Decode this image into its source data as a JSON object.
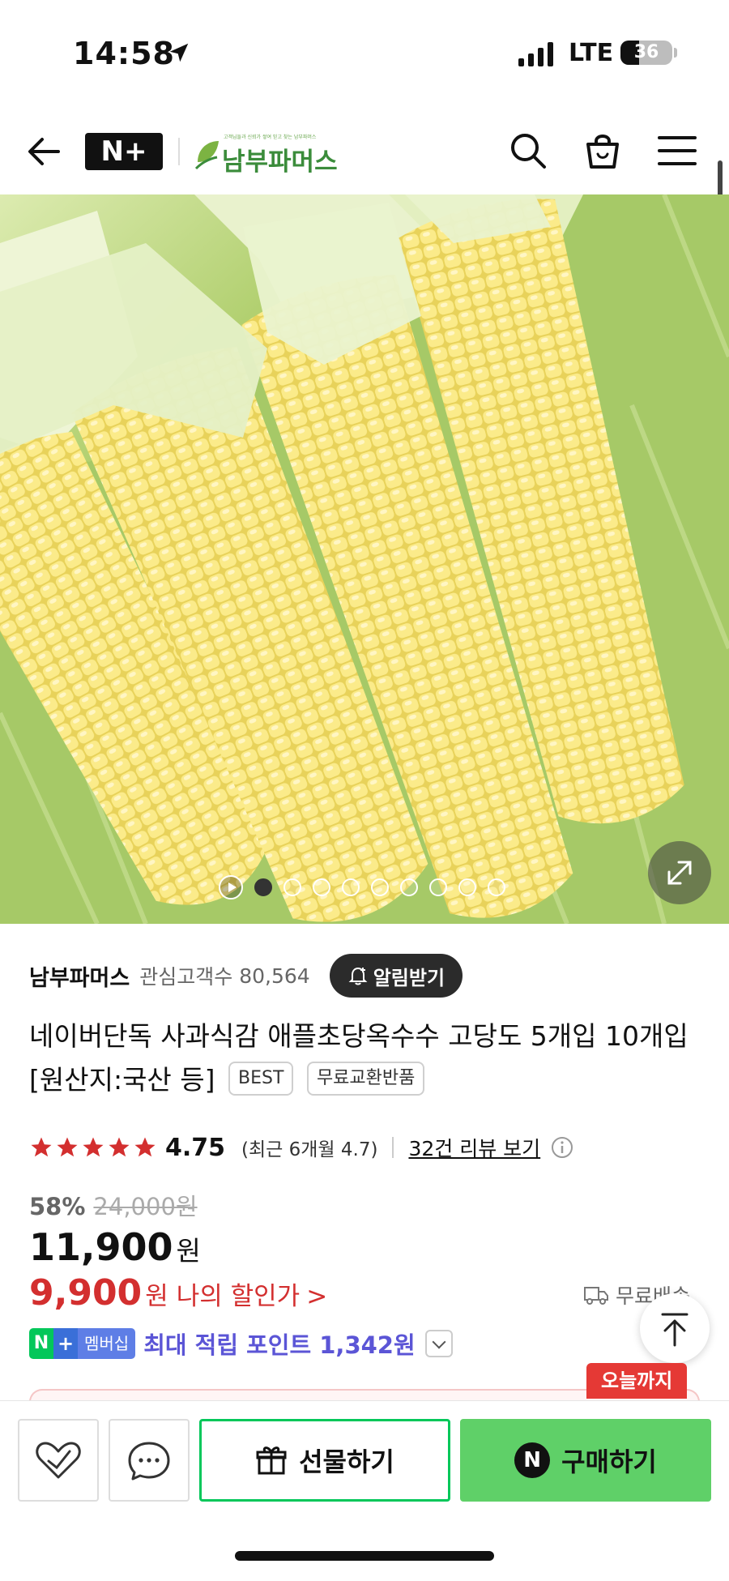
{
  "status_bar": {
    "time": "14:58",
    "network": "LTE",
    "battery": "36"
  },
  "header": {
    "np_logo": "N+",
    "store_tagline": "고객님들과 신뢰가 쌓여 믿고 찾는 남부파머스",
    "store_brand": "남부파머스"
  },
  "hero": {
    "image_alt": "사과식감 애플초당옥수수",
    "slides": 9,
    "active_slide": 1
  },
  "seller": {
    "name": "남부파머스",
    "fans_label": "관심고객수",
    "fans_count": "80,564",
    "alert_button": "알림받기"
  },
  "product": {
    "title": "네이버단독 사과식감 애플초당옥수수 고당도 5개입 10개입 [원산지:국산 등]",
    "badges": [
      "BEST",
      "무료교환반품"
    ]
  },
  "rating": {
    "score": "4.75",
    "stars": 5,
    "recent": "(최근 6개월 4.7)",
    "review_link": "32건 리뷰 보기"
  },
  "pricing": {
    "discount_rate": "58%",
    "original_price": "24,000원",
    "price": "11,900",
    "price_unit": "원",
    "my_price": "9,900",
    "my_price_unit": "원",
    "my_price_label": "나의 할인가",
    "my_price_chevron": ">",
    "shipping": "무료배송"
  },
  "membership": {
    "n_label": "N",
    "plus_label": "+",
    "membership_label": "멤버십",
    "points_text": "최대 적립 포인트 1,342원"
  },
  "promo": {
    "today_badge": "오늘까지"
  },
  "bottom_bar": {
    "gift_label": "선물하기",
    "buy_label": "구매하기",
    "npay_letter": "N"
  },
  "colors": {
    "naver_green": "#03c75a",
    "buy_green": "#5fd068",
    "sale_red": "#d32f2f",
    "points_purple": "#5b55d6"
  }
}
